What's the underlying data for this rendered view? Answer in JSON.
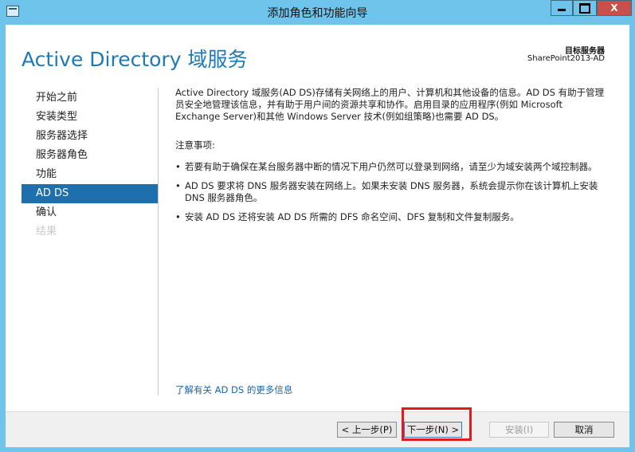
{
  "window": {
    "title": "添加角色和功能向导",
    "close_glyph": "X",
    "accent_color": "#1d7ab8"
  },
  "header": {
    "title": "Active Directory 域服务",
    "server_label": "目标服务器",
    "server_name": "SharePoint2013-AD"
  },
  "sidebar": {
    "items": [
      {
        "label": "开始之前",
        "state": "normal"
      },
      {
        "label": "安装类型",
        "state": "normal"
      },
      {
        "label": "服务器选择",
        "state": "normal"
      },
      {
        "label": "服务器角色",
        "state": "normal"
      },
      {
        "label": "功能",
        "state": "normal"
      },
      {
        "label": "AD DS",
        "state": "active"
      },
      {
        "label": "确认",
        "state": "normal"
      },
      {
        "label": "结果",
        "state": "disabled"
      }
    ]
  },
  "main": {
    "intro": "Active Directory 域服务(AD DS)存储有关网络上的用户、计算机和其他设备的信息。AD DS 有助于管理员安全地管理该信息，并有助于用户间的资源共享和协作。启用目录的应用程序(例如 Microsoft Exchange Server)和其他 Windows Server 技术(例如组策略)也需要 AD DS。",
    "notes_title": "注意事项:",
    "bullet_glyph": "•",
    "notes": [
      "若要有助于确保在某台服务器中断的情况下用户仍然可以登录到网络，请至少为域安装两个域控制器。",
      "AD DS 要求将 DNS 服务器安装在网络上。如果未安装 DNS 服务器，系统会提示你在该计算机上安装 DNS 服务器角色。",
      "安装 AD DS 还将安装 AD DS 所需的 DFS 命名空间、DFS 复制和文件复制服务。"
    ],
    "learn_more": "了解有关 AD DS 的更多信息"
  },
  "footer": {
    "prev_label": "< 上一步(P)",
    "next_label": "下一步(N) >",
    "install_label": "安装(I)",
    "cancel_label": "取消"
  }
}
